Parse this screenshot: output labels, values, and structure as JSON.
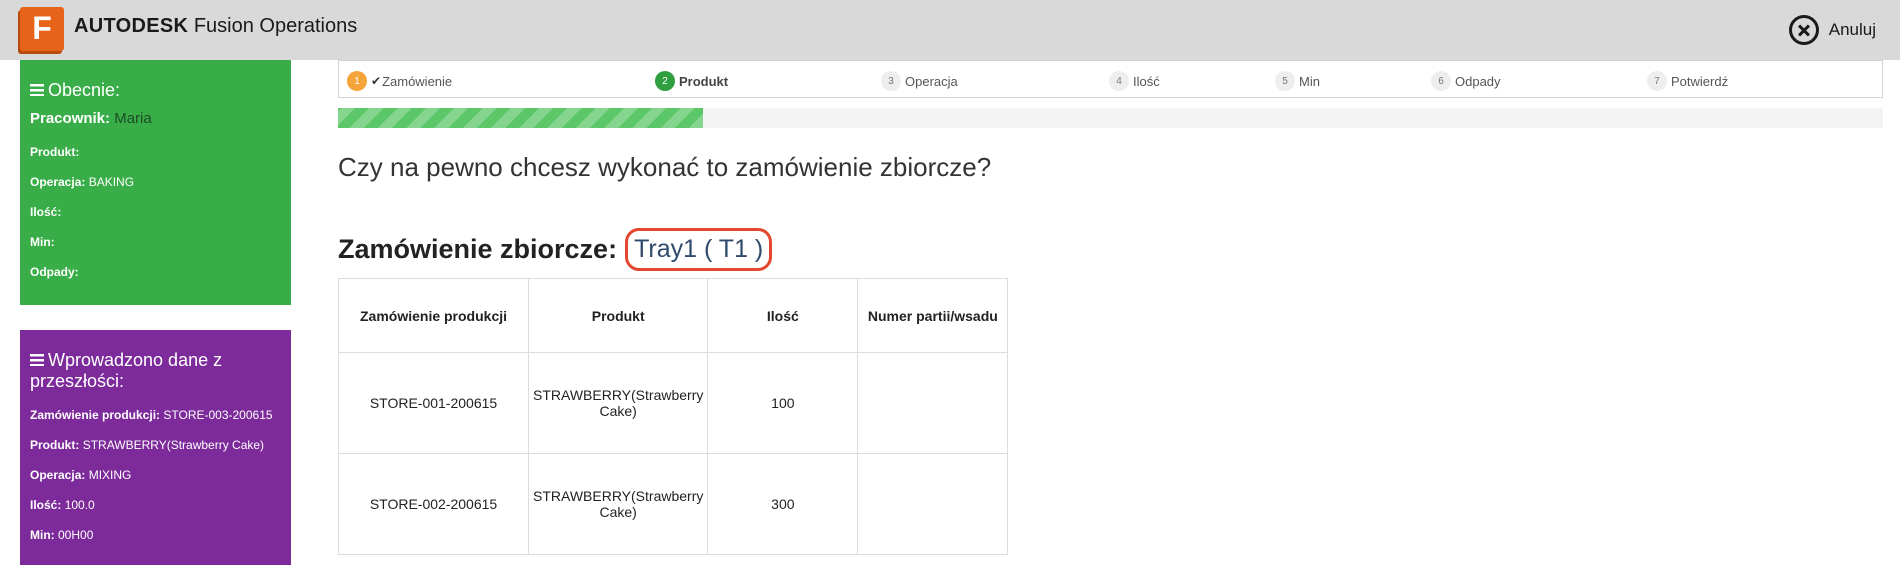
{
  "header": {
    "logo_letter": "F",
    "brand_bold": "AUTODESK",
    "brand_rest": " Fusion Operations",
    "cancel_label": "Anuluj",
    "cancel_icon": "close-circle-icon"
  },
  "current": {
    "title": "Obecnie:",
    "worker_label": "Pracownik:",
    "worker_value": "Maria",
    "fields": [
      {
        "label": "Produkt:",
        "value": ""
      },
      {
        "label": "Operacja:",
        "value": "BAKING"
      },
      {
        "label": "Ilość:",
        "value": ""
      },
      {
        "label": "Min:",
        "value": ""
      },
      {
        "label": "Odpady:",
        "value": ""
      }
    ],
    "color": "#39ae48"
  },
  "past": {
    "title": "Wprowadzono dane z przeszłości:",
    "fields": [
      {
        "label": "Zamówienie produkcji:",
        "value": "STORE-003-200615"
      },
      {
        "label": "Produkt:",
        "value": "STRAWBERRY(Strawberry Cake)"
      },
      {
        "label": "Operacja:",
        "value": "MIXING"
      },
      {
        "label": "Ilość:",
        "value": "100.0"
      },
      {
        "label": "Min:",
        "value": "00H00"
      }
    ],
    "color": "#7d2a9b"
  },
  "steps": [
    {
      "num": "1",
      "label": "Zamówienie",
      "state": "done"
    },
    {
      "num": "2",
      "label": "Produkt",
      "state": "active"
    },
    {
      "num": "3",
      "label": "Operacja",
      "state": "pending"
    },
    {
      "num": "4",
      "label": "Ilość",
      "state": "pending"
    },
    {
      "num": "5",
      "label": "Min",
      "state": "pending"
    },
    {
      "num": "6",
      "label": "Odpady",
      "state": "pending"
    },
    {
      "num": "7",
      "label": "Potwierdź",
      "state": "pending"
    }
  ],
  "progress_fraction": 0.236,
  "question": "Czy na pewno chcesz wykonać to zamówienie zbiorcze?",
  "batch": {
    "label": "Zamówienie zbiorcze:",
    "value": "Tray1 ( T1 )"
  },
  "table": {
    "headers": [
      "Zamówienie produkcji",
      "Produkt",
      "Ilość",
      "Numer partii/wsadu"
    ],
    "rows": [
      [
        "STORE-001-200615",
        "STRAWBERRY(Strawberry Cake)",
        "100",
        ""
      ],
      [
        "STORE-002-200615",
        "STRAWBERRY(Strawberry Cake)",
        "300",
        ""
      ]
    ]
  }
}
